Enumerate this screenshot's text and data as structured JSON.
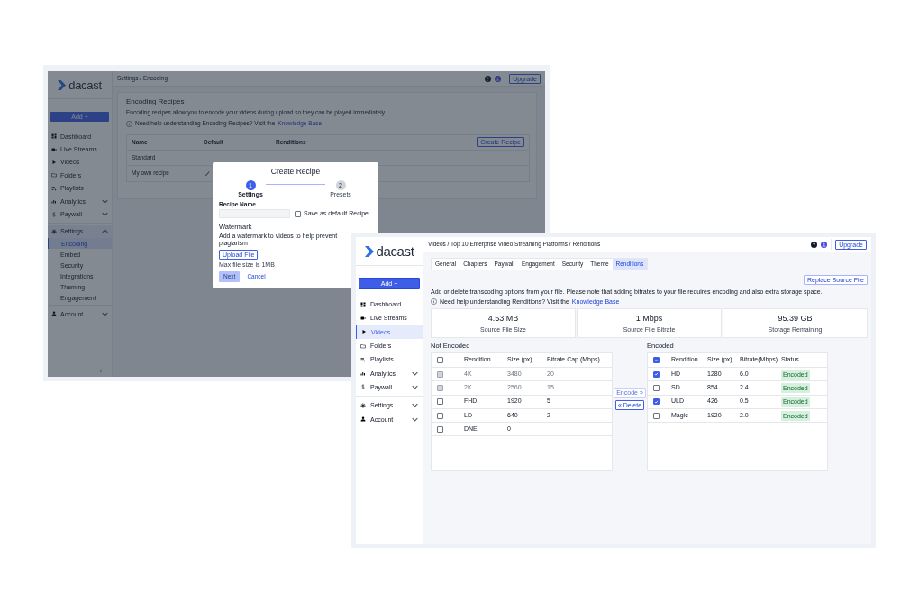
{
  "encoding_window": {
    "logo": "dacast",
    "add_button": "Add +",
    "sidebar": {
      "items": [
        {
          "label": "Dashboard",
          "kind": "link",
          "selected": false
        },
        {
          "label": "Live Streams",
          "kind": "link",
          "selected": false
        },
        {
          "label": "Videos",
          "kind": "link",
          "selected": false
        },
        {
          "label": "Folders",
          "kind": "link",
          "selected": false
        },
        {
          "label": "Playlists",
          "kind": "link",
          "selected": false
        },
        {
          "label": "Analytics",
          "kind": "menu",
          "expanded": false,
          "selected": false
        },
        {
          "label": "Paywall",
          "kind": "menu",
          "expanded": false,
          "selected": false
        },
        {
          "label": "Settings",
          "kind": "menu",
          "expanded": true,
          "selected": false,
          "children": [
            {
              "label": "Encoding",
              "selected": true
            },
            {
              "label": "Embed",
              "selected": false
            },
            {
              "label": "Security",
              "selected": false
            },
            {
              "label": "Integrations",
              "selected": false
            },
            {
              "label": "Theming",
              "selected": false
            },
            {
              "label": "Engagement",
              "selected": false
            }
          ]
        },
        {
          "label": "Account",
          "kind": "menu",
          "expanded": false,
          "selected": false
        }
      ]
    },
    "breadcrumb": "Settings / Encoding",
    "upgrade_button": "Upgrade",
    "card": {
      "title": "Encoding Recipes",
      "description": "Encoding recipes allow you to encode your videos during upload so they can be played immediately.",
      "help": {
        "text": "Need help understanding Encoding Recipes? Visit the",
        "link": "Knowledge Base"
      },
      "table": {
        "columns": [
          "Name",
          "Default",
          "Renditions"
        ],
        "create_button": "Create Recipe",
        "rows": [
          {
            "name": "Standard",
            "default": false
          },
          {
            "name": "My own recipe",
            "default": true
          }
        ]
      }
    },
    "modal": {
      "title": "Create Recipe",
      "steps": [
        {
          "number": "1",
          "label": "Settings",
          "active": true
        },
        {
          "number": "2",
          "label": "Presets",
          "active": false
        }
      ],
      "recipe_name_label": "Recipe Name",
      "default_checkbox": {
        "label": "Save as default Recipe",
        "checked": false
      },
      "watermark_title": "Watermark",
      "watermark_description": "Add a watermark to videos to help prevent plagiarism",
      "upload_button": "Upload File",
      "upload_hint": "Max file size is 1MB",
      "next_button": {
        "label": "Next",
        "disabled": true
      },
      "cancel_button": "Cancel"
    }
  },
  "renditions_window": {
    "logo": "dacast",
    "add_button": "Add +",
    "sidebar": {
      "items": [
        {
          "label": "Dashboard",
          "kind": "link",
          "selected": false
        },
        {
          "label": "Live Streams",
          "kind": "link",
          "selected": false
        },
        {
          "label": "Videos",
          "kind": "link",
          "selected": true
        },
        {
          "label": "Folders",
          "kind": "link",
          "selected": false
        },
        {
          "label": "Playlists",
          "kind": "link",
          "selected": false
        },
        {
          "label": "Analytics",
          "kind": "menu",
          "expanded": false,
          "selected": false
        },
        {
          "label": "Paywall",
          "kind": "menu",
          "expanded": false,
          "selected": false
        },
        {
          "label": "Settings",
          "kind": "menu",
          "expanded": false,
          "selected": false
        },
        {
          "label": "Account",
          "kind": "menu",
          "expanded": false,
          "selected": false
        }
      ]
    },
    "breadcrumb": "Videos / Top 10 Enterprise Video Streaming Platforms / Renditions",
    "upgrade_button": "Upgrade",
    "tabs": [
      {
        "label": "General",
        "selected": false
      },
      {
        "label": "Chapters",
        "selected": false
      },
      {
        "label": "Paywall",
        "selected": false
      },
      {
        "label": "Engagement",
        "selected": false
      },
      {
        "label": "Security",
        "selected": false
      },
      {
        "label": "Theme",
        "selected": false
      },
      {
        "label": "Renditions",
        "selected": true
      }
    ],
    "replace_button": "Replace Source File",
    "description": "Add or delete transcoding options from your file. Please note that adding bitrates to your file requires encoding and also extra storage space.",
    "help": {
      "text": "Need help understanding Renditions? Visit the",
      "link": "Knowledge Base"
    },
    "stats": [
      {
        "value": "4.53 MB",
        "label": "Source File Size"
      },
      {
        "value": "1 Mbps",
        "label": "Source File Bitrate"
      },
      {
        "value": "95.39 GB",
        "label": "Storage Remaining"
      }
    ],
    "not_encoded": {
      "title": "Not Encoded",
      "select_all": {
        "checked": false
      },
      "columns": [
        "Rendition",
        "Size (px)",
        "Bitrate Cap (Mbps)"
      ],
      "rows": [
        {
          "cells": [
            "4K",
            "3480",
            "20"
          ],
          "checked": false,
          "disabled": true
        },
        {
          "cells": [
            "2K",
            "2560",
            "15"
          ],
          "checked": false,
          "disabled": true
        },
        {
          "cells": [
            "FHD",
            "1920",
            "5"
          ],
          "checked": false,
          "disabled": false
        },
        {
          "cells": [
            "LD",
            "640",
            "2"
          ],
          "checked": false,
          "disabled": false
        },
        {
          "cells": [
            "DNE",
            "0"
          ],
          "checked": false,
          "disabled": false
        }
      ]
    },
    "encode_button": {
      "label": "Encode »",
      "disabled": true
    },
    "delete_button": {
      "label": "« Delete",
      "disabled": false
    },
    "encoded": {
      "title": "Encoded",
      "select_all": {
        "indeterminate": true
      },
      "columns": [
        "Rendition",
        "Size (px)",
        "Bitrate(Mbps)",
        "Status"
      ],
      "rows": [
        {
          "cells": [
            "HD",
            "1280",
            "6.0"
          ],
          "status": "Encoded",
          "checked": true
        },
        {
          "cells": [
            "SD",
            "854",
            "2.4"
          ],
          "status": "Encoded",
          "checked": false
        },
        {
          "cells": [
            "ULD",
            "426",
            "0.5"
          ],
          "status": "Encoded",
          "checked": true
        },
        {
          "cells": [
            "Magic",
            "1920",
            "2.0"
          ],
          "status": "Encoded",
          "checked": false
        }
      ]
    }
  }
}
